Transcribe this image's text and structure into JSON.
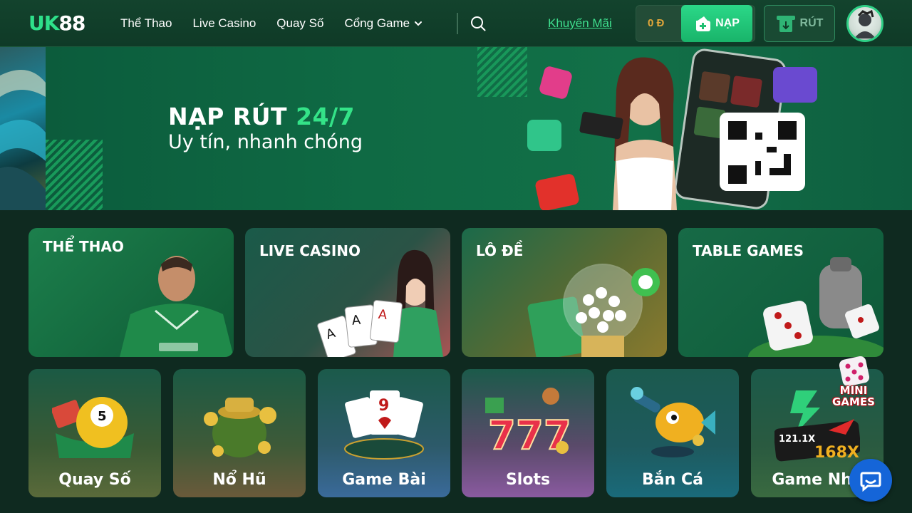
{
  "header": {
    "logo_part1": "UK",
    "logo_part2": "88",
    "nav": [
      {
        "label": "Thể Thao"
      },
      {
        "label": "Live Casino"
      },
      {
        "label": "Quay Số"
      },
      {
        "label": "Cổng Game"
      }
    ],
    "promo_label": "Khuyến Mãi",
    "balance": "0 Đ",
    "deposit_label": "NẠP",
    "withdraw_label": "RÚT"
  },
  "banner": {
    "title_white": "NẠP RÚT",
    "title_green": "24/7",
    "subtitle": "Uy tín, nhanh chóng"
  },
  "categories": [
    {
      "title": "THỂ THAO"
    },
    {
      "title": "LIVE CASINO"
    },
    {
      "title": "LÔ ĐỀ"
    },
    {
      "title": "TABLE GAMES"
    }
  ],
  "games": [
    {
      "label": "Quay Số"
    },
    {
      "label": "Nổ Hũ"
    },
    {
      "label": "Game Bài"
    },
    {
      "label": "Slots"
    },
    {
      "label": "Bắn Cá"
    },
    {
      "label": "Game Nha"
    }
  ],
  "mini_games": {
    "label_line1": "MINI",
    "label_line2": "GAMES"
  },
  "colors": {
    "accent": "#2ee08a",
    "header_bg": "#13432d",
    "page_bg": "#0f2a20",
    "balance": "#e3a73a",
    "chat": "#1565d8"
  },
  "icons": {
    "search": "search-icon",
    "chevron": "chevron-down-icon",
    "deposit": "wallet-plus-icon",
    "withdraw": "atm-withdraw-icon",
    "chat": "chat-bubble-icon"
  }
}
